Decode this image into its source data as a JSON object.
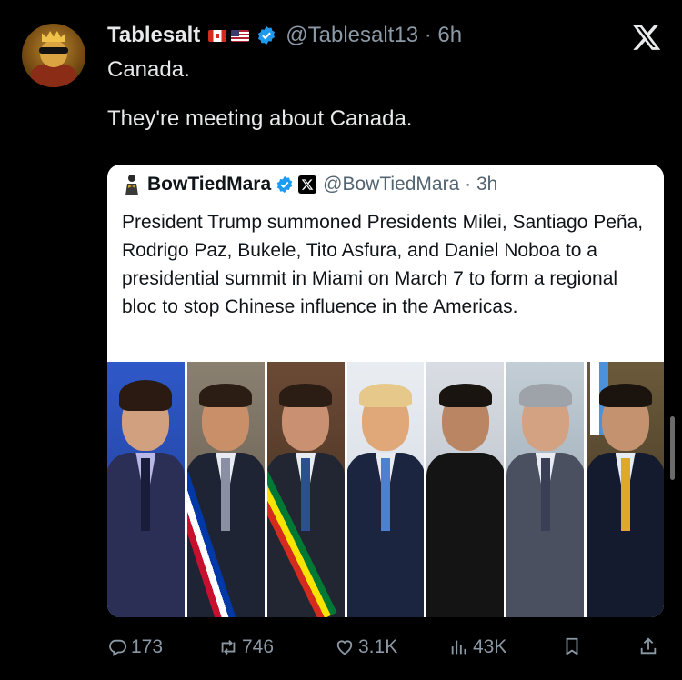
{
  "tweet": {
    "author_name": "Tablesalt",
    "author_handle": "@Tablesalt13",
    "separator": "·",
    "time": "6h",
    "text_lines": [
      "Canada.",
      "They're meeting about Canada."
    ]
  },
  "quoted": {
    "author_name": "BowTiedMara",
    "author_handle": "@BowTiedMara",
    "separator": "·",
    "time": "3h",
    "text": "President Trump summoned Presidents Milei, Santiago Peña, Rodrigo Paz, Bukele, Tito Asfura, and Daniel Noboa to a presidential summit in Miami on March 7 to form a regional bloc to stop Chinese influence in the Americas."
  },
  "actions": {
    "replies": "173",
    "reposts": "746",
    "likes": "3.1K",
    "views": "43K"
  },
  "icons": [
    "verified-badge-icon",
    "x-logo-icon",
    "reply-icon",
    "repost-icon",
    "like-icon",
    "views-icon",
    "bookmark-icon",
    "share-icon",
    "canada-flag-icon",
    "usa-flag-icon"
  ],
  "colors": {
    "background": "#000000",
    "verified": "#1d9bf0",
    "text": "#e7e9ea",
    "muted": "#8b98a5"
  }
}
